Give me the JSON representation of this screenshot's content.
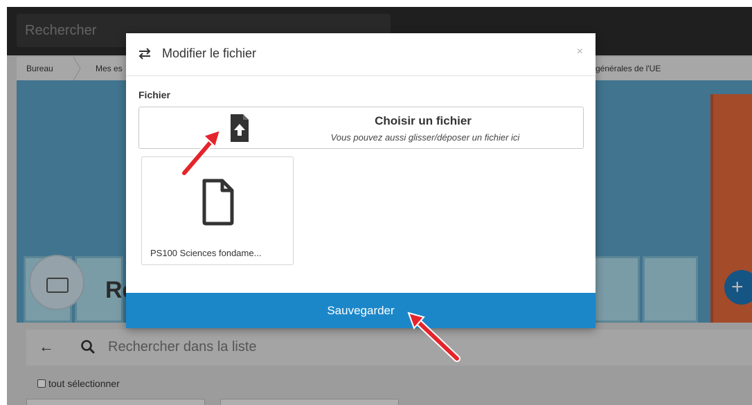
{
  "background": {
    "top_search": {
      "placeholder": "Rechercher"
    },
    "breadcrumb": [
      {
        "label": "Bureau"
      },
      {
        "label": "Mes es"
      },
      {
        "label": "générales de l'UE"
      }
    ],
    "banner": {
      "title_fragment": "Re",
      "plus_label": "+"
    },
    "list_search": {
      "back_icon": "arrow-left-icon",
      "search_icon": "search-icon",
      "placeholder": "Rechercher dans la liste"
    },
    "select_all": {
      "label": "tout sélectionner"
    }
  },
  "modal": {
    "header": {
      "icon": "swap-arrows-icon",
      "title": "Modifier le fichier",
      "close": "×"
    },
    "file_field": {
      "label": "Fichier",
      "upload_icon": "file-upload-icon",
      "choose_title": "Choisir un fichier",
      "choose_sub": "Vous pouvez aussi glisser/déposer un fichier ici"
    },
    "selected_file": {
      "icon": "document-icon",
      "name": "PS100 Sciences fondame..."
    },
    "save_label": "Sauvegarder"
  },
  "colors": {
    "primary_button": "#1b87c9",
    "annotation_arrow": "#e5242b",
    "banner": "#5aa1c6"
  }
}
